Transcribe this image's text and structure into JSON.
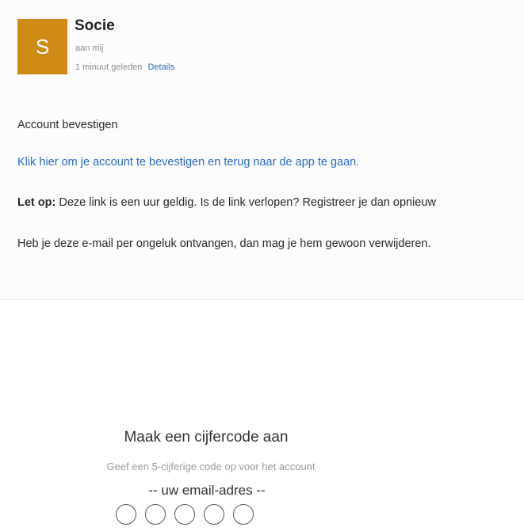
{
  "email": {
    "avatar_letter": "S",
    "avatar_color": "#d08a16",
    "sender": "Socie",
    "recipient": "aan mij",
    "time": "1 minuut geleden",
    "details_link": "Details",
    "subject_line": "Account bevestigen",
    "confirm_link": "Klik hier om je account te bevestigen en terug naar de app te gaan.",
    "note_label": "Let op:",
    "note_text": " Deze link is een uur geldig. Is de link verlopen? Registreer je dan opnieuw",
    "ignore_text": "Heb je deze e-mail per ongeluk ontvangen, dan mag je hem gewoon verwijderen."
  },
  "code_setup": {
    "title": "Maak een cijfercode aan",
    "subtitle": "Geef een 5-cijferige code op voor het account",
    "email_placeholder": "-- uw email-adres --",
    "pin_length": 5
  }
}
